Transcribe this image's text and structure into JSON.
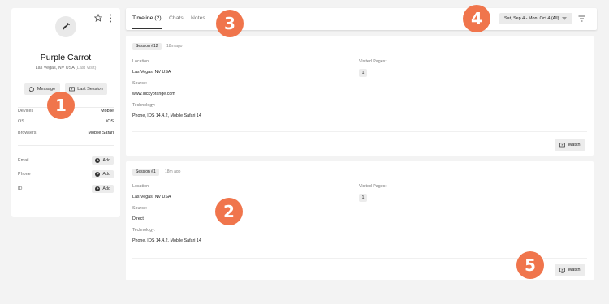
{
  "profile": {
    "name": "Purple Carrot",
    "location": "Las Vegas, NV USA",
    "location_note": "(Last Visit)",
    "message_label": "Message",
    "last_session_label": "Last Session",
    "details": [
      {
        "key": "Devices",
        "value": "Mobile"
      },
      {
        "key": "OS",
        "value": "iOS"
      },
      {
        "key": "Browsers",
        "value": "Mobile Safari"
      }
    ],
    "contacts": [
      {
        "key": "Email",
        "action": "Add"
      },
      {
        "key": "Phone",
        "action": "Add"
      },
      {
        "key": "ID",
        "action": "Add"
      }
    ]
  },
  "tabs": [
    {
      "label": "Timeline (2)",
      "active": true
    },
    {
      "label": "Chats",
      "active": false
    },
    {
      "label": "Notes",
      "active": false
    }
  ],
  "date_range": "Sat, Sep 4 - Mon, Oct 4 (All)",
  "field_labels": {
    "location": "Location:",
    "source": "Source:",
    "technology": "Technology:",
    "visited_pages": "Visited Pages:"
  },
  "sessions": [
    {
      "badge": "Session #12",
      "ago": "18m ago",
      "location": "Las Vegas, NV USA",
      "source": "www.luckyorange.com",
      "technology": "Phone, IOS 14.4.2, Mobile Safari 14",
      "visited_pages": "1",
      "watch_label": "Watch"
    },
    {
      "badge": "Session #1",
      "ago": "18m ago",
      "location": "Las Vegas, NV USA",
      "source": "Direct",
      "technology": "Phone, IOS 14.4.2, Mobile Safari 14",
      "visited_pages": "1",
      "watch_label": "Watch"
    }
  ],
  "markers": [
    "1",
    "2",
    "3",
    "4",
    "5"
  ],
  "colors": {
    "marker": "#f0754c",
    "card": "#ffffff",
    "background": "#f3f3f3"
  }
}
